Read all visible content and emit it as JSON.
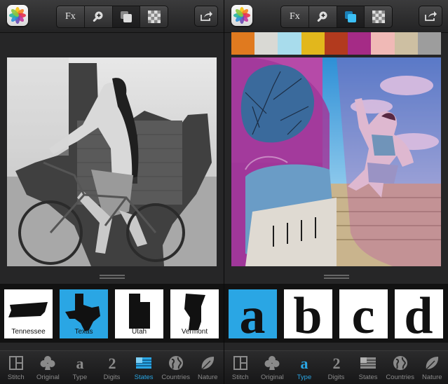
{
  "colors": {
    "accent": "#2aa6e4",
    "toolbar": "#2c2c2d",
    "background": "#262627"
  },
  "left_panel": {
    "toolbar": {
      "fx_label": "Fx",
      "active_tool": "layers"
    },
    "thumbnails": [
      {
        "label": "Tennessee",
        "selected": false
      },
      {
        "label": "Texas",
        "selected": true
      },
      {
        "label": "Utah",
        "selected": false
      },
      {
        "label": "Vermont",
        "selected": false
      }
    ],
    "tabs": [
      {
        "label": "Stitch",
        "icon": "stitch-icon",
        "selected": false
      },
      {
        "label": "Original",
        "icon": "club-icon",
        "selected": false
      },
      {
        "label": "Type",
        "icon": "type-icon",
        "selected": false
      },
      {
        "label": "Digits",
        "icon": "digits-icon",
        "selected": false
      },
      {
        "label": "States",
        "icon": "flag-icon",
        "selected": true
      },
      {
        "label": "Countries",
        "icon": "globe-icon",
        "selected": false
      },
      {
        "label": "Nature",
        "icon": "leaf-icon",
        "selected": false
      }
    ]
  },
  "right_panel": {
    "toolbar": {
      "fx_label": "Fx",
      "active_tool": "layers-color"
    },
    "palette": [
      "#e07a1f",
      "#d9d9d4",
      "#a8dcec",
      "#e2b71c",
      "#b23a1e",
      "#a52b86",
      "#f0b9b6",
      "#cdbfa2",
      "#9d9d9d"
    ],
    "thumbnails": [
      {
        "glyph": "a",
        "selected": true
      },
      {
        "glyph": "b",
        "selected": false
      },
      {
        "glyph": "c",
        "selected": false
      },
      {
        "glyph": "d",
        "selected": false
      }
    ],
    "tabs": [
      {
        "label": "Stitch",
        "icon": "stitch-icon",
        "selected": false
      },
      {
        "label": "Original",
        "icon": "club-icon",
        "selected": false
      },
      {
        "label": "Type",
        "icon": "type-icon",
        "selected": true
      },
      {
        "label": "Digits",
        "icon": "digits-icon",
        "selected": false
      },
      {
        "label": "States",
        "icon": "flag-icon",
        "selected": false
      },
      {
        "label": "Countries",
        "icon": "globe-icon",
        "selected": false
      },
      {
        "label": "Nature",
        "icon": "leaf-icon",
        "selected": false
      }
    ]
  }
}
